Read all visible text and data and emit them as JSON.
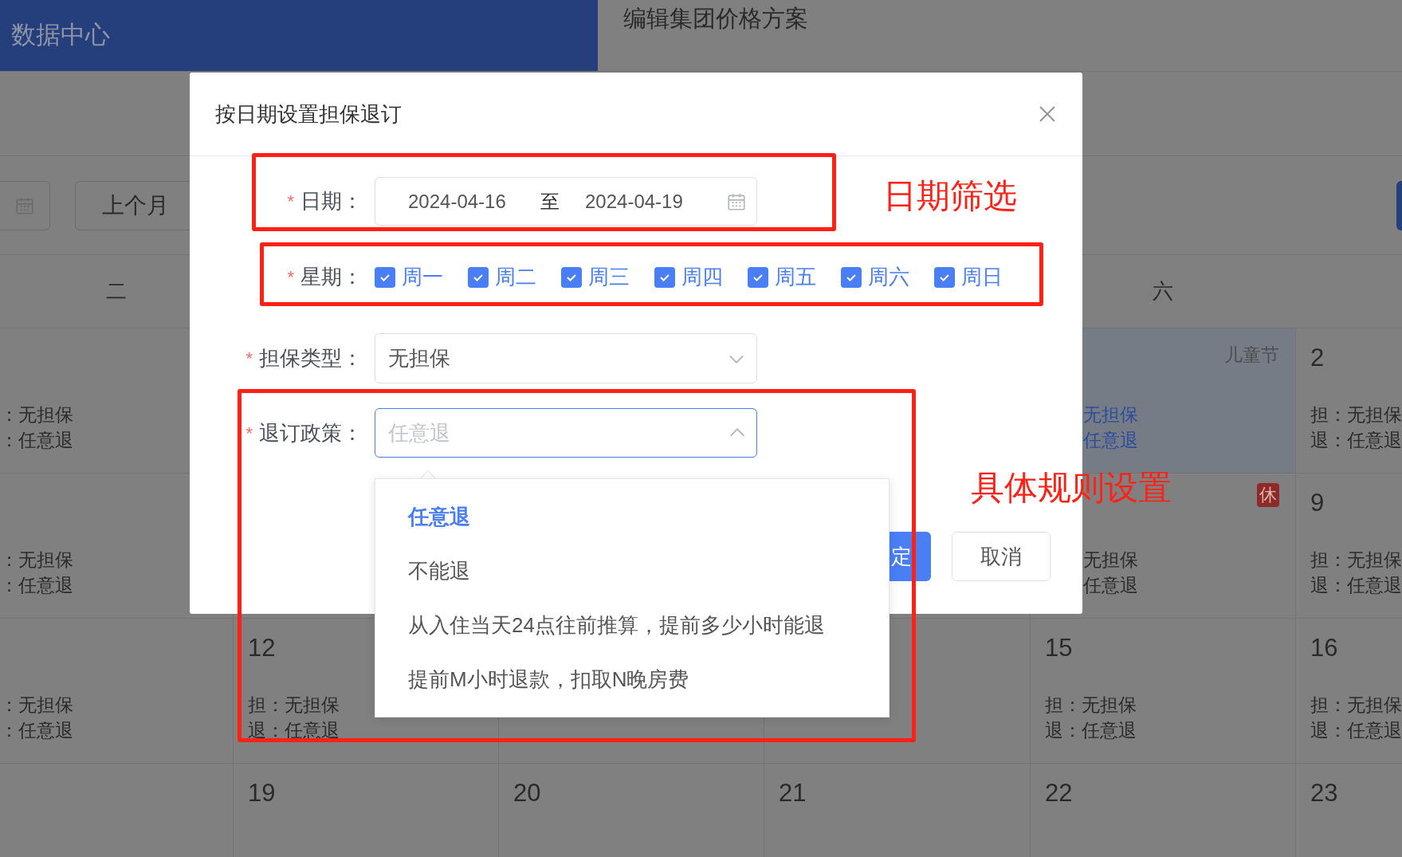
{
  "header": {
    "title": "数据中心"
  },
  "page_title": "编辑集团价格方案",
  "toolbar": {
    "prev_month": "上个月"
  },
  "weekday_headers": [
    "二",
    "六"
  ],
  "calendar_rows": [
    [
      {
        "guarantee": "：无担保",
        "refund": "：任意退",
        "selected": false
      },
      null,
      null,
      null,
      {
        "holiday": "儿童节",
        "guarantee": "无担保",
        "refund": "任意退",
        "selected": true
      },
      {
        "day": "2",
        "guarantee": "担：无担保",
        "refund": "退：任意退",
        "selected": false
      }
    ],
    [
      {
        "guarantee": "：无担保",
        "refund": "：任意退",
        "selected": false
      },
      null,
      null,
      null,
      {
        "badge": "休",
        "guarantee": "无担保",
        "refund": "任意退",
        "selected": false
      },
      {
        "day": "9",
        "guarantee": "担：无担保",
        "refund": "退：任意退",
        "selected": false
      }
    ],
    [
      {
        "guarantee": "：无担保",
        "refund": "：任意退",
        "selected": false
      },
      {
        "day": "12",
        "guarantee": "担：无担保",
        "refund": "退：任意退",
        "selected": false
      },
      null,
      null,
      {
        "day": "15",
        "guarantee": "担：无担保",
        "refund": "退：任意退",
        "selected": false
      },
      {
        "day": "16",
        "guarantee": "担：无担保",
        "refund": "退：任意退",
        "selected": false
      }
    ],
    [
      null,
      {
        "day": "19"
      },
      {
        "day": "20"
      },
      {
        "day": "21"
      },
      {
        "day": "22"
      },
      {
        "day": "23"
      }
    ]
  ],
  "dialog": {
    "title": "按日期设置担保退订",
    "required_mark": "*",
    "date": {
      "label": "日期：",
      "start": "2024-04-16",
      "separator": "至",
      "end": "2024-04-19"
    },
    "weekdays": {
      "label": "星期：",
      "options": [
        {
          "label": "周一",
          "checked": true
        },
        {
          "label": "周二",
          "checked": true
        },
        {
          "label": "周三",
          "checked": true
        },
        {
          "label": "周四",
          "checked": true
        },
        {
          "label": "周五",
          "checked": true
        },
        {
          "label": "周六",
          "checked": true
        },
        {
          "label": "周日",
          "checked": true
        }
      ]
    },
    "guarantee_type": {
      "label": "担保类型：",
      "value": "无担保"
    },
    "refund_policy": {
      "label": "退订政策：",
      "placeholder": "任意退",
      "expanded": true,
      "options": [
        {
          "label": "任意退",
          "selected": true
        },
        {
          "label": "不能退",
          "selected": false
        },
        {
          "label": "从入住当天24点往前推算，提前多少小时能退",
          "selected": false
        },
        {
          "label": "提前M小时退款，扣取N晚房费",
          "selected": false
        }
      ]
    },
    "confirm": "定",
    "cancel": "取消"
  },
  "annotations": [
    "日期筛选",
    "具体规则设置"
  ]
}
